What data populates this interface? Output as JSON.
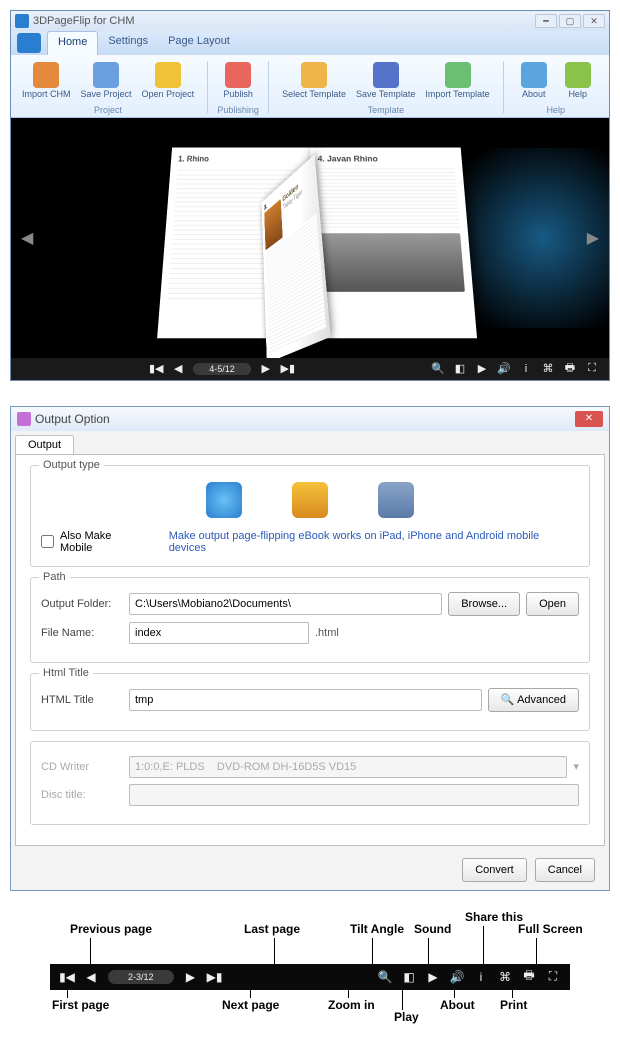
{
  "app": {
    "title": "3DPageFlip for CHM",
    "tabs": [
      "Home",
      "Settings",
      "Page Layout"
    ],
    "active_tab": 0,
    "ribbon": {
      "groups": [
        {
          "label": "Project",
          "buttons": [
            {
              "label": "Import CHM",
              "color": "#e38a3d"
            },
            {
              "label": "Save Project",
              "color": "#6aa0e0"
            },
            {
              "label": "Open Project",
              "color": "#f0c23a"
            }
          ]
        },
        {
          "label": "Publishing",
          "buttons": [
            {
              "label": "Publish",
              "color": "#e9665f"
            }
          ]
        },
        {
          "label": "Template",
          "buttons": [
            {
              "label": "Select Template",
              "color": "#efb44a"
            },
            {
              "label": "Save Template",
              "color": "#5573c8"
            },
            {
              "label": "Import Template",
              "color": "#6bbf73"
            }
          ]
        },
        {
          "label": "Help",
          "buttons": [
            {
              "label": "About",
              "color": "#5aa5dd"
            },
            {
              "label": "Help",
              "color": "#8bc34a"
            }
          ]
        }
      ]
    },
    "preview": {
      "page_indicator": "4-5/12",
      "right_heading": "4. Javan Rhino",
      "mid_heading_num": "3.",
      "mid_heading": "Golden",
      "mid_sub": "Tabby Tiger",
      "left_heading": "1. Rhino"
    }
  },
  "dialog": {
    "title": "Output Option",
    "tab": "Output",
    "groups": {
      "output_type": {
        "legend": "Output type",
        "checkbox": "Also Make Mobile",
        "note": "Make output page-flipping eBook works on iPad, iPhone and Android mobile devices"
      },
      "path": {
        "legend": "Path",
        "output_folder_label": "Output Folder:",
        "output_folder_value": "C:\\Users\\Mobiano2\\Documents\\",
        "browse": "Browse...",
        "open": "Open",
        "file_name_label": "File Name:",
        "file_name_value": "index",
        "ext": ".html"
      },
      "html_title": {
        "legend": "Html Title",
        "label": "HTML Title",
        "value": "tmp",
        "advanced": "Advanced"
      },
      "cd": {
        "writer_label": "CD Writer",
        "writer_value": "1:0:0,E: PLDS    DVD-ROM DH-16D5S VD15",
        "disc_label": "Disc title:"
      }
    },
    "buttons": {
      "convert": "Convert",
      "cancel": "Cancel"
    }
  },
  "legend": {
    "page_indicator": "2-3/12",
    "labels": {
      "first": "First page",
      "prev": "Previous page",
      "next": "Next page",
      "last": "Last page",
      "zoom": "Zoom in",
      "tilt": "Tilt Angle",
      "play": "Play",
      "sound": "Sound",
      "about": "About",
      "share": "Share this",
      "print": "Print",
      "full": "Full Screen"
    }
  }
}
